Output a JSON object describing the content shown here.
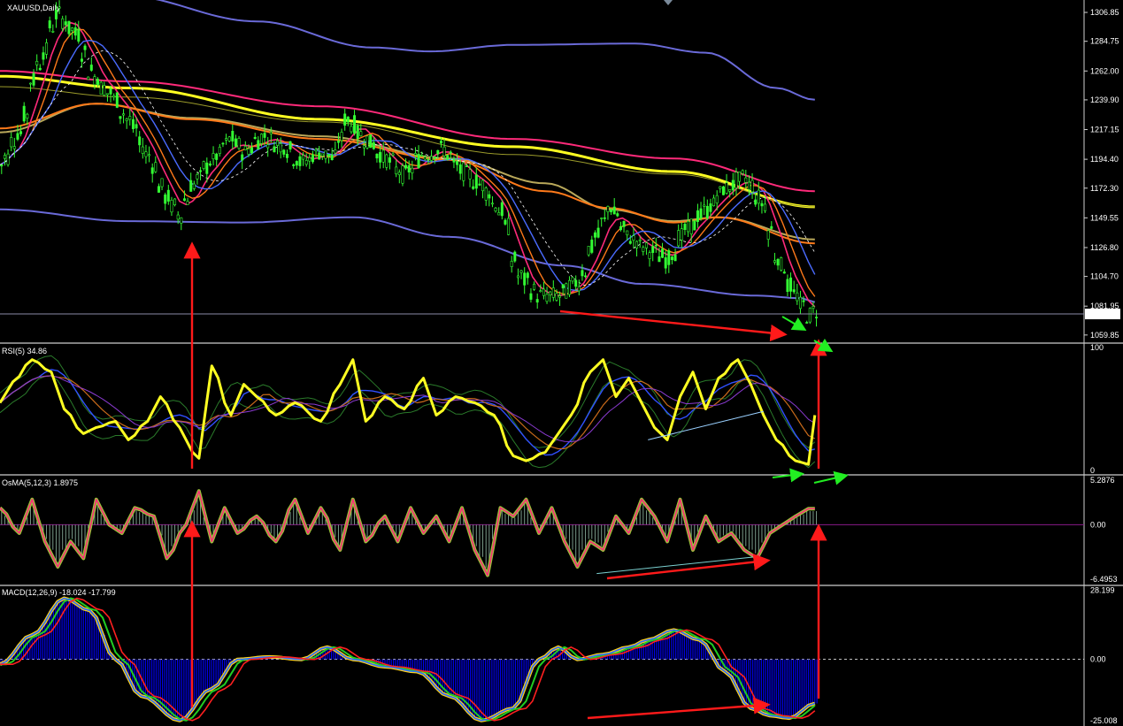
{
  "colors": {
    "background": "#000000",
    "axis_text": "#ffffff",
    "separator": "#ffffff",
    "candle_bull": "#33ff33",
    "candle_bear": "#33ff33",
    "arrow_red": "#ff1a1a",
    "arrow_green": "#22ee22",
    "yellow": "#ffff22",
    "magenta": "#ff2a7a",
    "blue": "#4a6bff",
    "band": "#6a6ad8",
    "khaki": "#b9a85a",
    "orange": "#ff7a1a",
    "macd_hist": "#0000ee"
  },
  "chart_data": [
    {
      "type": "line",
      "pane": "price",
      "title": "XAUUSD,Daily",
      "y_ticks": [
        "1306.85",
        "1284.75",
        "1262.00",
        "1239.90",
        "1217.15",
        "1194.40",
        "1172.30",
        "1149.55",
        "1126.80",
        "1104.70",
        "1081.95",
        "1059.85"
      ],
      "ylim": [
        1055.0,
        1315.0
      ],
      "current_price_label": "1075.95",
      "current_price": 1075.95,
      "x_points": 140,
      "series": [
        {
          "role": "upper_band",
          "color": "band",
          "anchors": [
            [
              19,
              1320
            ],
            [
              40,
              1300
            ],
            [
              58,
              1280
            ],
            [
              67,
              1277
            ],
            [
              80,
              1282
            ],
            [
              99,
              1283
            ],
            [
              110,
              1276
            ],
            [
              121,
              1249
            ],
            [
              127,
              1240
            ]
          ]
        },
        {
          "role": "lower_band",
          "color": "band",
          "anchors": [
            [
              0,
              1156
            ],
            [
              20,
              1147
            ],
            [
              38,
              1146
            ],
            [
              55,
              1150
            ],
            [
              70,
              1135
            ],
            [
              88,
              1113
            ],
            [
              100,
              1099
            ],
            [
              118,
              1090
            ],
            [
              125,
              1088
            ],
            [
              127,
              1085
            ]
          ]
        },
        {
          "role": "ma_magenta",
          "color": "magenta",
          "anchors": [
            [
              0,
              1262
            ],
            [
              20,
              1254
            ],
            [
              50,
              1235
            ],
            [
              80,
              1210
            ],
            [
              105,
              1195
            ],
            [
              127,
              1170
            ]
          ]
        },
        {
          "role": "ma_yellow",
          "color": "yellow",
          "anchors": [
            [
              0,
              1258
            ],
            [
              20,
              1249
            ],
            [
              50,
              1225
            ],
            [
              80,
              1204
            ],
            [
              105,
              1185
            ],
            [
              127,
              1158
            ]
          ]
        },
        {
          "role": "ma_khaki_slow",
          "color": "khaki",
          "anchors": [
            [
              0,
              1215
            ],
            [
              15,
              1237
            ],
            [
              30,
              1226
            ],
            [
              50,
              1212
            ],
            [
              70,
              1195
            ],
            [
              85,
              1176
            ],
            [
              95,
              1156
            ],
            [
              105,
              1147
            ],
            [
              112,
              1150
            ],
            [
              127,
              1133
            ]
          ]
        },
        {
          "role": "ma_orange",
          "color": "orange",
          "anchors": [
            [
              0,
              1218
            ],
            [
              15,
              1237
            ],
            [
              30,
              1225
            ],
            [
              50,
              1210
            ],
            [
              70,
              1194
            ],
            [
              85,
              1170
            ],
            [
              95,
              1157
            ],
            [
              105,
              1146
            ],
            [
              112,
              1150
            ],
            [
              127,
              1130
            ]
          ]
        }
      ],
      "price_anchors": [
        [
          0,
          1190
        ],
        [
          3,
          1215
        ],
        [
          6,
          1268
        ],
        [
          9,
          1305
        ],
        [
          12,
          1290
        ],
        [
          14,
          1262
        ],
        [
          17,
          1245
        ],
        [
          20,
          1225
        ],
        [
          23,
          1198
        ],
        [
          26,
          1165
        ],
        [
          28,
          1152
        ],
        [
          30,
          1175
        ],
        [
          33,
          1193
        ],
        [
          36,
          1210
        ],
        [
          38,
          1200
        ],
        [
          41,
          1212
        ],
        [
          44,
          1205
        ],
        [
          47,
          1192
        ],
        [
          50,
          1200
        ],
        [
          52,
          1195
        ],
        [
          54,
          1225
        ],
        [
          57,
          1210
        ],
        [
          60,
          1195
        ],
        [
          63,
          1183
        ],
        [
          66,
          1198
        ],
        [
          69,
          1202
        ],
        [
          72,
          1185
        ],
        [
          75,
          1175
        ],
        [
          78,
          1155
        ],
        [
          81,
          1105
        ],
        [
          84,
          1090
        ],
        [
          87,
          1090
        ],
        [
          90,
          1100
        ],
        [
          93,
          1135
        ],
        [
          95,
          1158
        ],
        [
          98,
          1135
        ],
        [
          101,
          1125
        ],
        [
          104,
          1118
        ],
        [
          107,
          1140
        ],
        [
          110,
          1155
        ],
        [
          113,
          1172
        ],
        [
          116,
          1180
        ],
        [
          119,
          1160
        ],
        [
          121,
          1120
        ],
        [
          124,
          1090
        ],
        [
          126,
          1075
        ],
        [
          127,
          1078
        ]
      ]
    },
    {
      "type": "line",
      "pane": "rsi",
      "title": "RSI(5) 34.86",
      "y_ticks": [
        "100",
        "0"
      ],
      "ylim": [
        -2,
        102
      ],
      "series": [
        {
          "role": "rsi",
          "color": "yellow",
          "anchors": [
            [
              0,
              55
            ],
            [
              2,
              72
            ],
            [
              5,
              90
            ],
            [
              8,
              80
            ],
            [
              10,
              50
            ],
            [
              13,
              30
            ],
            [
              15,
              35
            ],
            [
              18,
              40
            ],
            [
              20,
              25
            ],
            [
              23,
              40
            ],
            [
              25,
              60
            ],
            [
              28,
              35
            ],
            [
              30,
              15
            ],
            [
              31,
              10
            ],
            [
              33,
              85
            ],
            [
              36,
              45
            ],
            [
              38,
              70
            ],
            [
              40,
              60
            ],
            [
              43,
              45
            ],
            [
              46,
              55
            ],
            [
              50,
              40
            ],
            [
              53,
              70
            ],
            [
              55,
              90
            ],
            [
              57,
              40
            ],
            [
              60,
              60
            ],
            [
              63,
              50
            ],
            [
              66,
              75
            ],
            [
              68,
              45
            ],
            [
              71,
              60
            ],
            [
              74,
              55
            ],
            [
              77,
              45
            ],
            [
              80,
              12
            ],
            [
              82,
              8
            ],
            [
              85,
              15
            ],
            [
              87,
              30
            ],
            [
              89,
              45
            ],
            [
              92,
              80
            ],
            [
              94,
              90
            ],
            [
              96,
              60
            ],
            [
              98,
              75
            ],
            [
              100,
              55
            ],
            [
              102,
              35
            ],
            [
              104,
              25
            ],
            [
              106,
              60
            ],
            [
              108,
              80
            ],
            [
              110,
              50
            ],
            [
              112,
              75
            ],
            [
              115,
              90
            ],
            [
              117,
              70
            ],
            [
              119,
              45
            ],
            [
              121,
              25
            ],
            [
              124,
              8
            ],
            [
              126,
              5
            ],
            [
              127,
              45
            ]
          ]
        }
      ]
    },
    {
      "type": "line",
      "pane": "osma",
      "title": "OsMA(5,12,3) 1.8975",
      "y_ticks": [
        "5.2876",
        "0.00",
        "-6.4953"
      ],
      "ylim": [
        -7.0,
        5.6
      ],
      "series": [
        {
          "role": "osma",
          "color": "khaki",
          "anchors": [
            [
              0,
              2
            ],
            [
              3,
              -1
            ],
            [
              5,
              3
            ],
            [
              7,
              -2
            ],
            [
              9,
              -5
            ],
            [
              11,
              -2
            ],
            [
              13,
              -4
            ],
            [
              15,
              3
            ],
            [
              17,
              0
            ],
            [
              19,
              -1
            ],
            [
              21,
              2
            ],
            [
              24,
              1
            ],
            [
              26,
              -4
            ],
            [
              29,
              0
            ],
            [
              31,
              4
            ],
            [
              33,
              -2
            ],
            [
              35,
              2
            ],
            [
              37,
              -1
            ],
            [
              40,
              1
            ],
            [
              43,
              -2
            ],
            [
              46,
              3
            ],
            [
              48,
              -1
            ],
            [
              50,
              2
            ],
            [
              53,
              -3
            ],
            [
              55,
              3
            ],
            [
              57,
              -2
            ],
            [
              60,
              1
            ],
            [
              62,
              -2
            ],
            [
              64,
              2
            ],
            [
              66,
              -1
            ],
            [
              68,
              1
            ],
            [
              70,
              -2
            ],
            [
              72,
              2
            ],
            [
              74,
              -3
            ],
            [
              76,
              -6
            ],
            [
              78,
              2
            ],
            [
              80,
              1
            ],
            [
              82,
              3
            ],
            [
              84,
              -1
            ],
            [
              86,
              2
            ],
            [
              88,
              -2
            ],
            [
              90,
              -5
            ],
            [
              92,
              -2
            ],
            [
              94,
              -3
            ],
            [
              96,
              1
            ],
            [
              98,
              -1
            ],
            [
              100,
              3
            ],
            [
              102,
              1
            ],
            [
              104,
              -2
            ],
            [
              106,
              3
            ],
            [
              108,
              -3
            ],
            [
              110,
              1
            ],
            [
              112,
              -2
            ],
            [
              114,
              -1
            ],
            [
              116,
              -3
            ],
            [
              118,
              -4
            ],
            [
              120,
              -1
            ],
            [
              122,
              0
            ],
            [
              124,
              1
            ],
            [
              126,
              1.9
            ]
          ]
        }
      ]
    },
    {
      "type": "line",
      "pane": "macd",
      "title": "MACD(12,26,9) -18.024 -17.799",
      "y_ticks": [
        "28.199",
        "0.00",
        "-25.008"
      ],
      "ylim": [
        -26.5,
        29.5
      ],
      "series": [
        {
          "role": "macd",
          "color": "macd_hist",
          "anchors": [
            [
              0,
              -2
            ],
            [
              5,
              10
            ],
            [
              10,
              25
            ],
            [
              14,
              20
            ],
            [
              18,
              0
            ],
            [
              22,
              -15
            ],
            [
              28,
              -25
            ],
            [
              33,
              -12
            ],
            [
              37,
              0
            ],
            [
              42,
              1
            ],
            [
              47,
              0
            ],
            [
              51,
              5
            ],
            [
              55,
              0
            ],
            [
              60,
              -3
            ],
            [
              65,
              -5
            ],
            [
              70,
              -15
            ],
            [
              75,
              -25
            ],
            [
              80,
              -20
            ],
            [
              84,
              0
            ],
            [
              87,
              5
            ],
            [
              90,
              0
            ],
            [
              94,
              2
            ],
            [
              98,
              5
            ],
            [
              101,
              8
            ],
            [
              105,
              12
            ],
            [
              109,
              8
            ],
            [
              113,
              -5
            ],
            [
              117,
              -20
            ],
            [
              120,
              -23
            ],
            [
              123,
              -24
            ],
            [
              127,
              -18
            ]
          ]
        }
      ]
    }
  ]
}
